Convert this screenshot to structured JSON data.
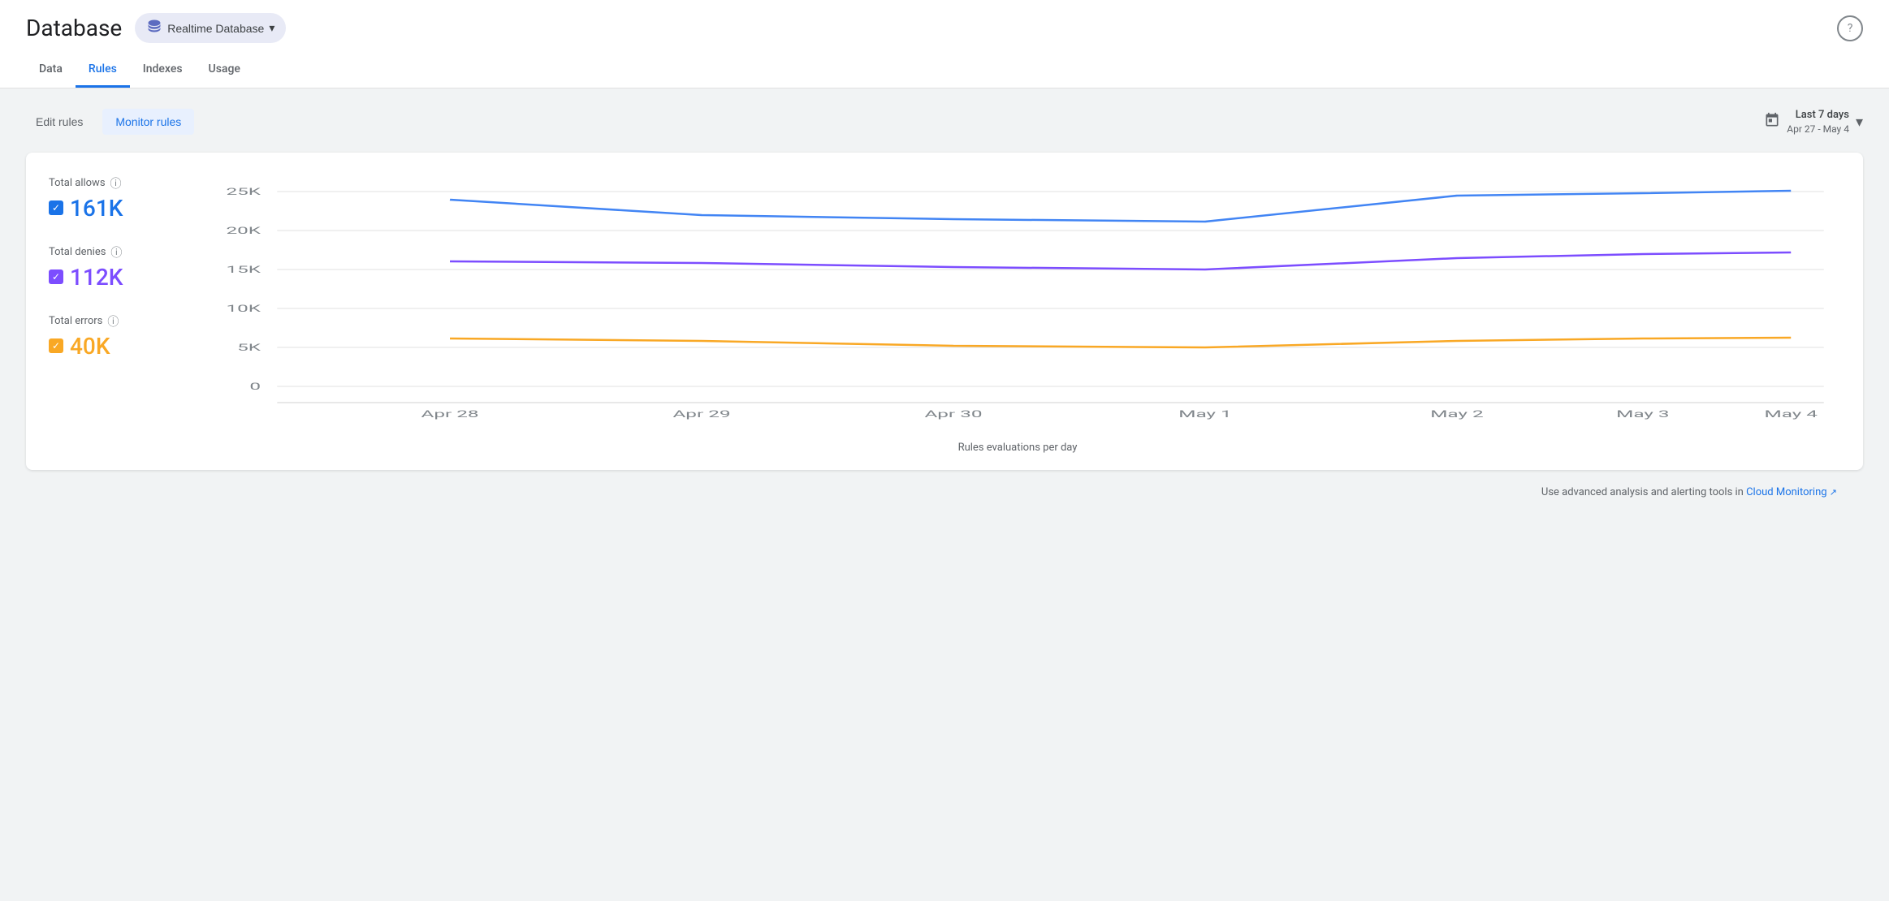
{
  "header": {
    "title": "Database",
    "db_selector": {
      "label": "Realtime Database",
      "icon": "database-layers-icon"
    },
    "help_icon": "?"
  },
  "nav": {
    "tabs": [
      {
        "id": "data",
        "label": "Data",
        "active": false
      },
      {
        "id": "rules",
        "label": "Rules",
        "active": true
      },
      {
        "id": "indexes",
        "label": "Indexes",
        "active": false
      },
      {
        "id": "usage",
        "label": "Usage",
        "active": false
      }
    ]
  },
  "toolbar": {
    "edit_rules_label": "Edit rules",
    "monitor_rules_label": "Monitor rules",
    "date_range": {
      "title": "Last 7 days",
      "subtitle": "Apr 27 - May 4"
    }
  },
  "chart": {
    "legend": [
      {
        "id": "allows",
        "label": "Total allows",
        "value": "161K",
        "color": "blue",
        "checkbox_color": "#1a73e8"
      },
      {
        "id": "denies",
        "label": "Total denies",
        "value": "112K",
        "color": "purple",
        "checkbox_color": "#7c4dff"
      },
      {
        "id": "errors",
        "label": "Total errors",
        "value": "40K",
        "color": "orange",
        "checkbox_color": "#f9a825"
      }
    ],
    "y_axis": [
      "25K",
      "20K",
      "15K",
      "10K",
      "5K",
      "0"
    ],
    "x_axis": [
      "Apr 28",
      "Apr 29",
      "Apr 30",
      "May 1",
      "May 2",
      "May 3",
      "May 4"
    ],
    "x_axis_label": "Rules evaluations per day",
    "series": {
      "allows": {
        "color": "#4285f4",
        "points": [
          24000,
          22000,
          21500,
          21200,
          24500,
          24800,
          25200
        ]
      },
      "denies": {
        "color": "#7c4dff",
        "points": [
          16000,
          15800,
          15400,
          15000,
          16500,
          17000,
          17200
        ]
      },
      "errors": {
        "color": "#f9a825",
        "points": [
          6200,
          5800,
          5200,
          5000,
          5800,
          6100,
          6200
        ]
      }
    }
  },
  "footer": {
    "text": "Use advanced analysis and alerting tools in",
    "link_text": "Cloud Monitoring",
    "external_icon": "↗"
  }
}
